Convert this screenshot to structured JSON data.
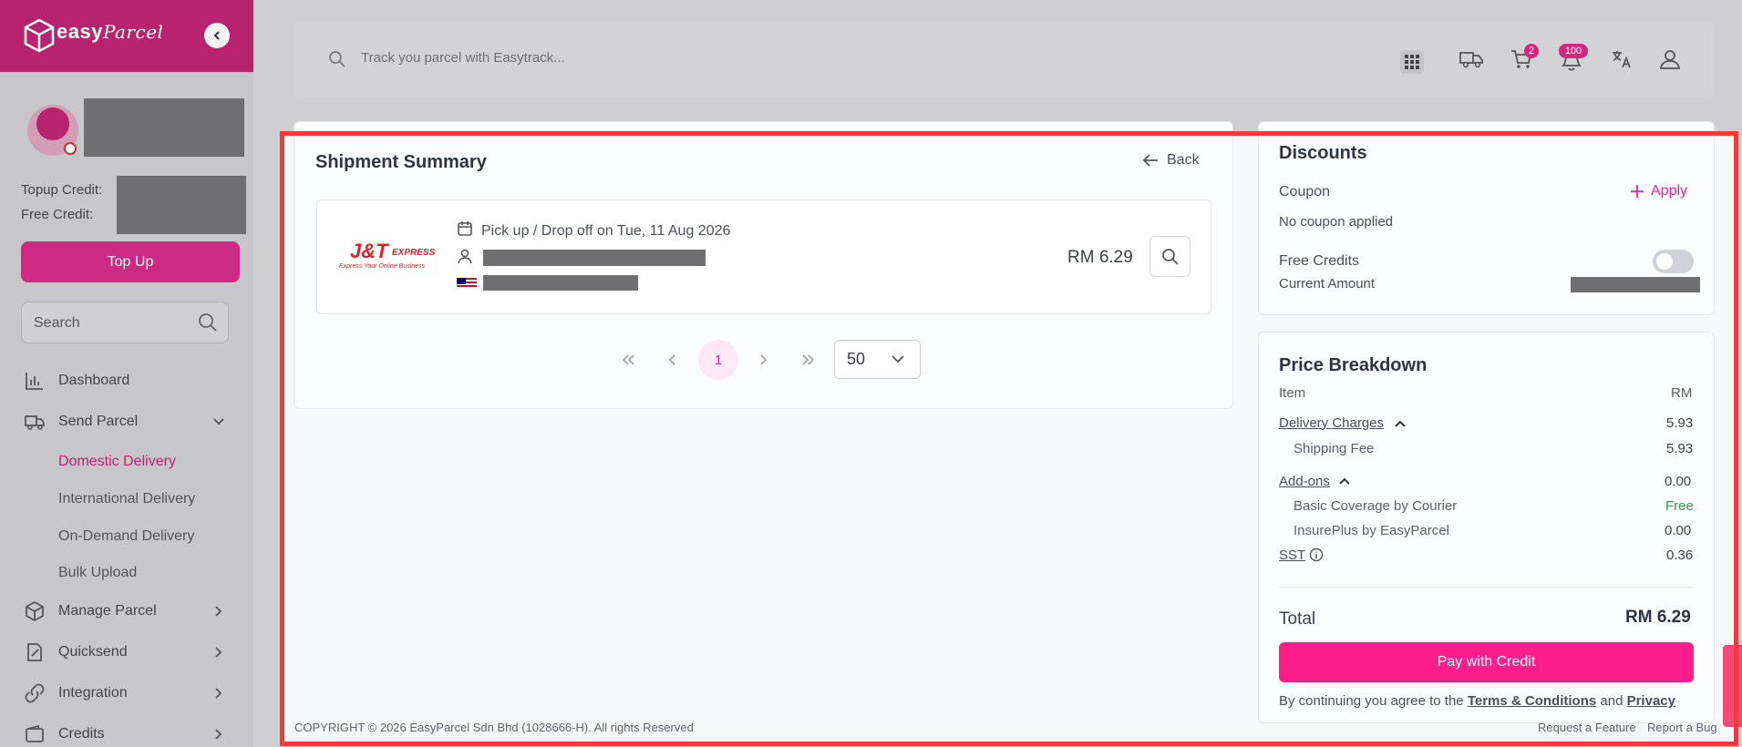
{
  "brand": {
    "name": "easy",
    "name_script": "Parcel"
  },
  "sidebar": {
    "topup_credit_label": "Topup Credit:",
    "free_credit_label": "Free Credit:",
    "topup_button": "Top Up",
    "search_placeholder": "Search",
    "items": [
      {
        "label": "Dashboard",
        "icon": "chart-icon"
      },
      {
        "label": "Send Parcel",
        "icon": "truck-icon"
      },
      {
        "label": "Manage Parcel",
        "icon": "box-icon"
      },
      {
        "label": "Quicksend",
        "icon": "document-edit-icon"
      },
      {
        "label": "Integration",
        "icon": "link-icon"
      },
      {
        "label": "Credits",
        "icon": "wallet-icon"
      }
    ],
    "send_parcel_sub": [
      {
        "label": "Domestic Delivery",
        "active": true
      },
      {
        "label": "International Delivery",
        "active": false
      },
      {
        "label": "On-Demand Delivery",
        "active": false
      },
      {
        "label": "Bulk Upload",
        "active": false
      }
    ]
  },
  "header": {
    "track_placeholder": "Track you parcel with Easytrack...",
    "cart_badge": "2",
    "notification_badge": "100"
  },
  "summary": {
    "title": "Shipment Summary",
    "back_label": "Back",
    "courier_logo_text": "J&T",
    "courier_logo_sub": "EXPRESS",
    "courier_tagline": "Express Your Online Business",
    "pickup_text": "Pick up / Drop off on Tue, 11 Aug 2026",
    "price": "RM 6.29",
    "current_page": "1",
    "per_page": "50"
  },
  "discounts": {
    "title": "Discounts",
    "coupon_label": "Coupon",
    "apply_label": "Apply",
    "no_coupon": "No coupon applied",
    "free_credits_label": "Free Credits",
    "current_amount_label": "Current Amount"
  },
  "price_breakdown": {
    "title": "Price Breakdown",
    "item_header": "Item",
    "currency_header": "RM",
    "delivery_charges_label": "Delivery Charges",
    "delivery_charges_value": "5.93",
    "shipping_fee_label": "Shipping Fee",
    "shipping_fee_value": "5.93",
    "addons_label": "Add-ons",
    "addons_value": "0.00",
    "basic_coverage_label": "Basic Coverage by Courier",
    "basic_coverage_value": "Free",
    "insureplus_label": "InsurePlus by EasyParcel",
    "insureplus_value": "0.00",
    "sst_label": "SST",
    "sst_value": "0.36",
    "total_label": "Total",
    "total_value": "RM 6.29",
    "pay_button": "Pay with Credit",
    "agree_prefix": "By continuing you agree to the",
    "terms_label": "Terms & Conditions",
    "and_label": "and",
    "privacy_label": "Privacy"
  },
  "footer": {
    "copyright": "COPYRIGHT © 2026 EasyParcel Sdn Bhd (1028666-H). All rights Reserved",
    "request_feature": "Request a Feature",
    "report_bug": "Report a Bug"
  },
  "colors": {
    "brand": "#b8226f",
    "accent": "#ff1d8b",
    "free_green": "#2e9d4f",
    "highlight": "#f23a3a"
  }
}
